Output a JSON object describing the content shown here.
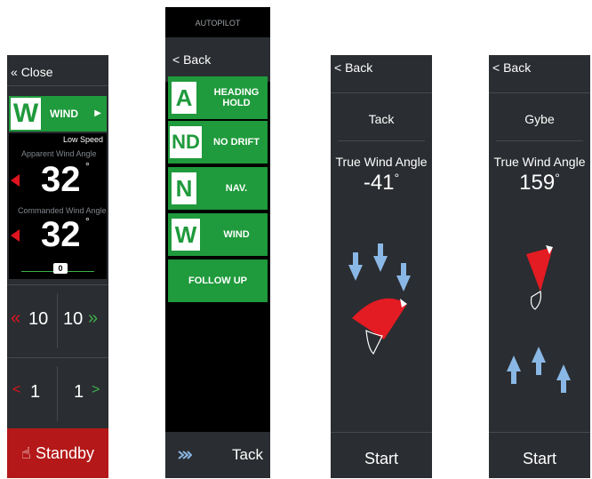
{
  "panel1": {
    "close_label": "Close",
    "mode_letter": "W",
    "mode_label": "WIND",
    "speed_label": "Low Speed",
    "apparent_label": "Apparent Wind Angle",
    "apparent_value": "32",
    "commanded_label": "Commanded Wind Angle",
    "commanded_value": "32",
    "deg": "°",
    "counter": "0",
    "big_step_left": "10",
    "big_step_right": "10",
    "small_step_left": "1",
    "small_step_right": "1",
    "standby_label": "Standby"
  },
  "panel2": {
    "title": "AUTOPILOT",
    "back_label": "Back",
    "buttons": [
      {
        "letter": "A",
        "label": "HEADING HOLD"
      },
      {
        "letter": "ND",
        "label": "NO DRIFT"
      },
      {
        "letter": "N",
        "label": "NAV."
      },
      {
        "letter": "W",
        "label": "WIND"
      },
      {
        "letter": "",
        "label": "FOLLOW UP"
      }
    ],
    "tack_label": "Tack"
  },
  "panel3": {
    "back_label": "Back",
    "title": "Tack",
    "twa_label": "True Wind Angle",
    "twa_value": "-41",
    "deg": "°",
    "start_label": "Start"
  },
  "panel4": {
    "back_label": "Back",
    "title": "Gybe",
    "twa_label": "True Wind Angle",
    "twa_value": "159",
    "deg": "°",
    "start_label": "Start"
  },
  "colors": {
    "accent_green": "#1f9a3c",
    "alarm_red": "#e0141e",
    "panel_bg": "#2a2d31",
    "wind_arrow": "#8ab8e6"
  }
}
